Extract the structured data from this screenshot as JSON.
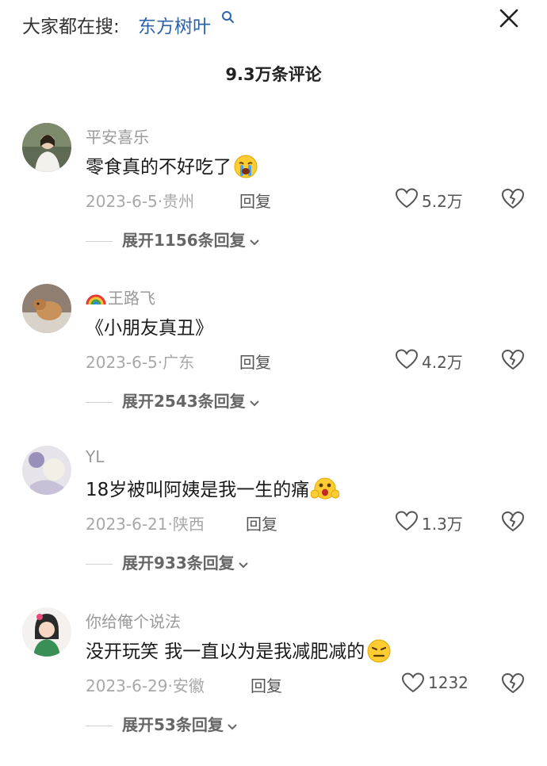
{
  "header": {
    "search_prefix": "大家都在搜:",
    "search_term": "东方树叶",
    "comments_count": "9.3万条评论"
  },
  "comments": [
    {
      "user": "平安喜乐",
      "text": "零食真的不好吃了",
      "emoji": "crying-face",
      "date": "2023-6-5",
      "location": "贵州",
      "reply": "回复",
      "likes": "5.2万",
      "expand": "展开1156条回复"
    },
    {
      "user": "王路飞",
      "user_emoji": "rainbow",
      "text": "《小朋友真丑》",
      "date": "2023-6-5",
      "location": "广东",
      "reply": "回复",
      "likes": "4.2万",
      "expand": "展开2543条回复"
    },
    {
      "user": "YL",
      "text": "18岁被叫阿姨是我一生的痛",
      "emoji": "shocked-face",
      "date": "2023-6-21",
      "location": "陕西",
      "reply": "回复",
      "likes": "1.3万",
      "expand": "展开933条回复"
    },
    {
      "user": "你给俺个说法",
      "text": "没开玩笑 我一直以为是我减肥减的",
      "emoji": "annoyed-face",
      "date": "2023-6-29",
      "location": "安徽",
      "reply": "回复",
      "likes": "1232",
      "expand": "展开53条回复"
    }
  ],
  "icons": {
    "search": "search-icon",
    "close": "close-icon",
    "like": "heart-icon",
    "dislike": "broken-heart-icon",
    "expand": "chevron-down-icon"
  },
  "colors": {
    "link": "#2f63a8",
    "meta": "#a8a8a8"
  }
}
